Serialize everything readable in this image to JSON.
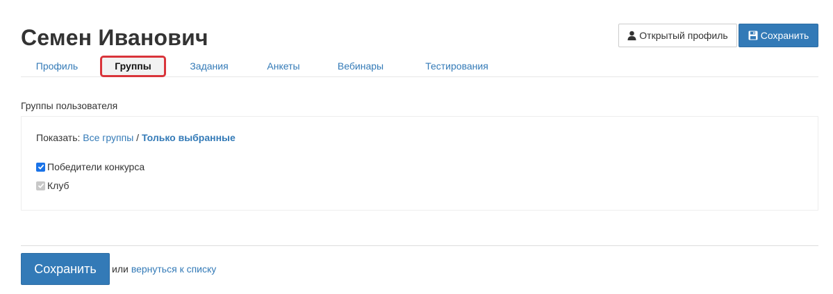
{
  "header": {
    "title": "Семен Иванович",
    "open_profile_label": "Открытый профиль",
    "save_label": "Сохранить"
  },
  "tabs": [
    {
      "label": "Профиль",
      "active": false
    },
    {
      "label": "Группы",
      "active": true
    },
    {
      "label": "Задания",
      "active": false
    },
    {
      "label": "Анкеты",
      "active": false
    },
    {
      "label": "Вебинары",
      "active": false
    },
    {
      "label": "Тестирования",
      "active": false
    }
  ],
  "groups": {
    "section_label": "Группы пользователя",
    "filter": {
      "prefix": "Показать:",
      "all_label": "Все группы",
      "separator": "/",
      "selected_label": "Только выбранные"
    },
    "items": [
      {
        "label": "Победители конкурса",
        "checked": true,
        "disabled": false
      },
      {
        "label": "Клуб",
        "checked": true,
        "disabled": true
      }
    ]
  },
  "footer": {
    "save_label": "Сохранить",
    "or_text": "или",
    "back_link": "вернуться к списку"
  },
  "colors": {
    "primary": "#337ab7",
    "active_tab_border": "#d9343a",
    "checkbox": "#1a73e8"
  },
  "icons": {
    "open_profile": "user-icon",
    "save": "floppy-disk-icon",
    "checkbox": "checkmark-icon"
  }
}
